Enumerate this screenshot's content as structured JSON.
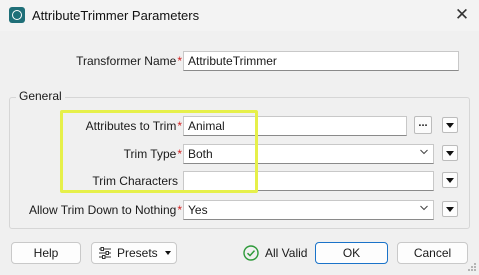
{
  "window": {
    "title": "AttributeTrimmer Parameters"
  },
  "transformer_name": {
    "label": "Transformer Name",
    "required_mark": "*",
    "value": "AttributeTrimmer"
  },
  "general_group": {
    "label": "General"
  },
  "attributes_to_trim": {
    "label": "Attributes to Trim",
    "required_mark": "*",
    "value": "Animal",
    "browse_label": "..."
  },
  "trim_type": {
    "label": "Trim Type",
    "required_mark": "*",
    "value": "Both"
  },
  "trim_characters": {
    "label": "Trim Characters",
    "value": ""
  },
  "allow_trim_down": {
    "label": "Allow Trim Down to Nothing",
    "required_mark": "*",
    "value": "Yes"
  },
  "footer": {
    "help_label": "Help",
    "presets_label": "Presets",
    "status_text": "All Valid",
    "ok_label": "OK",
    "cancel_label": "Cancel"
  },
  "colors": {
    "highlight": "#e6f04a",
    "required": "#d21f1f",
    "valid_green": "#2e9a3a",
    "ok_border": "#1a73c9"
  },
  "icons": [
    "app-icon",
    "close-icon",
    "chevron-down-icon",
    "menu-triangle-icon",
    "presets-icon",
    "check-circle-icon",
    "resize-grip-icon"
  ]
}
